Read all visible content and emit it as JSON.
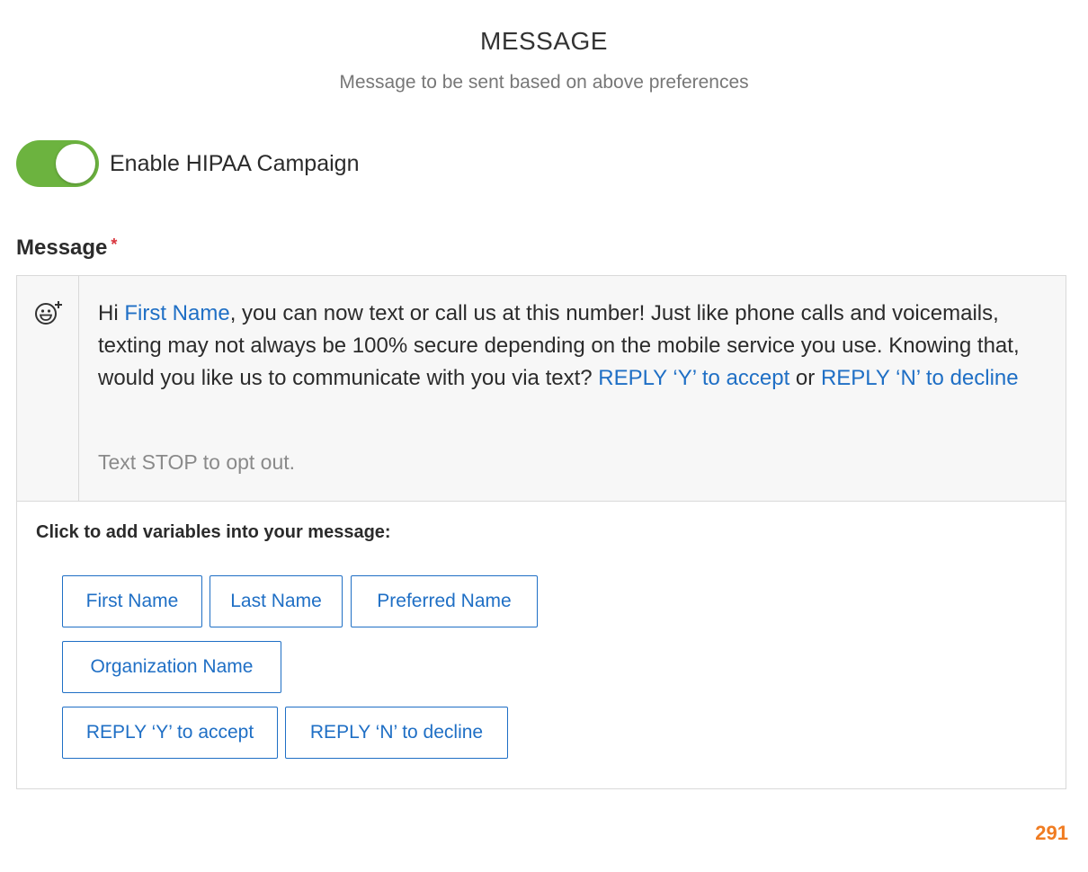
{
  "header": {
    "title": "MESSAGE",
    "subtitle": "Message to be sent based on above preferences"
  },
  "hipaa_toggle": {
    "label": "Enable HIPAA Campaign",
    "enabled": true,
    "on_color": "#6cb33f"
  },
  "message_field": {
    "label": "Message",
    "required_marker": "*",
    "emoji_icon": "emoji-add-icon",
    "body": {
      "greeting": "Hi ",
      "var_first_name": "First Name",
      "text_main": ", you can now text or call us at this number! Just like phone calls and voicemails, texting may not always be 100% secure depending on the mobile service you use. Knowing that, would you like us to communicate with you via text? ",
      "var_reply_y": "REPLY ‘Y’ to accept",
      "connector": " or ",
      "var_reply_n": "REPLY ‘N’ to decline"
    },
    "opt_out_text": "Text STOP to opt out."
  },
  "variables": {
    "title": "Click to add variables into your message:",
    "buttons": [
      "First Name",
      "Last Name",
      "Preferred Name",
      "Organization Name",
      "REPLY ‘Y’ to accept",
      "REPLY ‘N’ to decline"
    ]
  },
  "character_count": "291",
  "colors": {
    "variable_link": "#1f6fc5",
    "required": "#d9363e",
    "counter": "#f07c22"
  }
}
